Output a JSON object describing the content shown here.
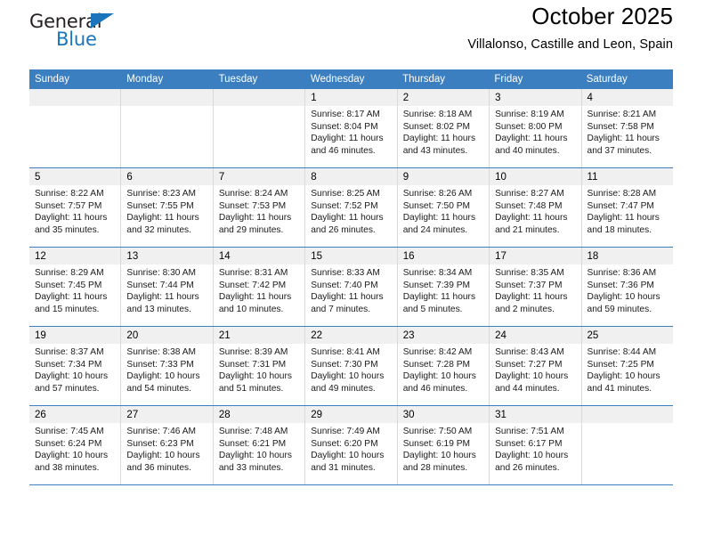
{
  "brand": {
    "name_top": "General",
    "name_bottom": "Blue",
    "triangle_color": "#1b75bb"
  },
  "header": {
    "title": "October 2025",
    "subtitle": "Villalonso, Castille and Leon, Spain"
  },
  "theme": {
    "header_bg": "#3c7fc0",
    "header_text": "#ffffff",
    "daynum_band_bg": "#f0f0f0",
    "cell_border": "#d9d9d9",
    "week_rule": "#3c7fc0"
  },
  "weekday_headers": [
    "Sunday",
    "Monday",
    "Tuesday",
    "Wednesday",
    "Thursday",
    "Friday",
    "Saturday"
  ],
  "weeks": [
    [
      {
        "day": "",
        "empty": true,
        "sunrise": "",
        "sunset": "",
        "daylight_line1": "",
        "daylight_line2": ""
      },
      {
        "day": "",
        "empty": true,
        "sunrise": "",
        "sunset": "",
        "daylight_line1": "",
        "daylight_line2": ""
      },
      {
        "day": "",
        "empty": true,
        "sunrise": "",
        "sunset": "",
        "daylight_line1": "",
        "daylight_line2": ""
      },
      {
        "day": "1",
        "empty": false,
        "sunrise": "Sunrise: 8:17 AM",
        "sunset": "Sunset: 8:04 PM",
        "daylight_line1": "Daylight: 11 hours",
        "daylight_line2": "and 46 minutes."
      },
      {
        "day": "2",
        "empty": false,
        "sunrise": "Sunrise: 8:18 AM",
        "sunset": "Sunset: 8:02 PM",
        "daylight_line1": "Daylight: 11 hours",
        "daylight_line2": "and 43 minutes."
      },
      {
        "day": "3",
        "empty": false,
        "sunrise": "Sunrise: 8:19 AM",
        "sunset": "Sunset: 8:00 PM",
        "daylight_line1": "Daylight: 11 hours",
        "daylight_line2": "and 40 minutes."
      },
      {
        "day": "4",
        "empty": false,
        "sunrise": "Sunrise: 8:21 AM",
        "sunset": "Sunset: 7:58 PM",
        "daylight_line1": "Daylight: 11 hours",
        "daylight_line2": "and 37 minutes."
      }
    ],
    [
      {
        "day": "5",
        "empty": false,
        "sunrise": "Sunrise: 8:22 AM",
        "sunset": "Sunset: 7:57 PM",
        "daylight_line1": "Daylight: 11 hours",
        "daylight_line2": "and 35 minutes."
      },
      {
        "day": "6",
        "empty": false,
        "sunrise": "Sunrise: 8:23 AM",
        "sunset": "Sunset: 7:55 PM",
        "daylight_line1": "Daylight: 11 hours",
        "daylight_line2": "and 32 minutes."
      },
      {
        "day": "7",
        "empty": false,
        "sunrise": "Sunrise: 8:24 AM",
        "sunset": "Sunset: 7:53 PM",
        "daylight_line1": "Daylight: 11 hours",
        "daylight_line2": "and 29 minutes."
      },
      {
        "day": "8",
        "empty": false,
        "sunrise": "Sunrise: 8:25 AM",
        "sunset": "Sunset: 7:52 PM",
        "daylight_line1": "Daylight: 11 hours",
        "daylight_line2": "and 26 minutes."
      },
      {
        "day": "9",
        "empty": false,
        "sunrise": "Sunrise: 8:26 AM",
        "sunset": "Sunset: 7:50 PM",
        "daylight_line1": "Daylight: 11 hours",
        "daylight_line2": "and 24 minutes."
      },
      {
        "day": "10",
        "empty": false,
        "sunrise": "Sunrise: 8:27 AM",
        "sunset": "Sunset: 7:48 PM",
        "daylight_line1": "Daylight: 11 hours",
        "daylight_line2": "and 21 minutes."
      },
      {
        "day": "11",
        "empty": false,
        "sunrise": "Sunrise: 8:28 AM",
        "sunset": "Sunset: 7:47 PM",
        "daylight_line1": "Daylight: 11 hours",
        "daylight_line2": "and 18 minutes."
      }
    ],
    [
      {
        "day": "12",
        "empty": false,
        "sunrise": "Sunrise: 8:29 AM",
        "sunset": "Sunset: 7:45 PM",
        "daylight_line1": "Daylight: 11 hours",
        "daylight_line2": "and 15 minutes."
      },
      {
        "day": "13",
        "empty": false,
        "sunrise": "Sunrise: 8:30 AM",
        "sunset": "Sunset: 7:44 PM",
        "daylight_line1": "Daylight: 11 hours",
        "daylight_line2": "and 13 minutes."
      },
      {
        "day": "14",
        "empty": false,
        "sunrise": "Sunrise: 8:31 AM",
        "sunset": "Sunset: 7:42 PM",
        "daylight_line1": "Daylight: 11 hours",
        "daylight_line2": "and 10 minutes."
      },
      {
        "day": "15",
        "empty": false,
        "sunrise": "Sunrise: 8:33 AM",
        "sunset": "Sunset: 7:40 PM",
        "daylight_line1": "Daylight: 11 hours",
        "daylight_line2": "and 7 minutes."
      },
      {
        "day": "16",
        "empty": false,
        "sunrise": "Sunrise: 8:34 AM",
        "sunset": "Sunset: 7:39 PM",
        "daylight_line1": "Daylight: 11 hours",
        "daylight_line2": "and 5 minutes."
      },
      {
        "day": "17",
        "empty": false,
        "sunrise": "Sunrise: 8:35 AM",
        "sunset": "Sunset: 7:37 PM",
        "daylight_line1": "Daylight: 11 hours",
        "daylight_line2": "and 2 minutes."
      },
      {
        "day": "18",
        "empty": false,
        "sunrise": "Sunrise: 8:36 AM",
        "sunset": "Sunset: 7:36 PM",
        "daylight_line1": "Daylight: 10 hours",
        "daylight_line2": "and 59 minutes."
      }
    ],
    [
      {
        "day": "19",
        "empty": false,
        "sunrise": "Sunrise: 8:37 AM",
        "sunset": "Sunset: 7:34 PM",
        "daylight_line1": "Daylight: 10 hours",
        "daylight_line2": "and 57 minutes."
      },
      {
        "day": "20",
        "empty": false,
        "sunrise": "Sunrise: 8:38 AM",
        "sunset": "Sunset: 7:33 PM",
        "daylight_line1": "Daylight: 10 hours",
        "daylight_line2": "and 54 minutes."
      },
      {
        "day": "21",
        "empty": false,
        "sunrise": "Sunrise: 8:39 AM",
        "sunset": "Sunset: 7:31 PM",
        "daylight_line1": "Daylight: 10 hours",
        "daylight_line2": "and 51 minutes."
      },
      {
        "day": "22",
        "empty": false,
        "sunrise": "Sunrise: 8:41 AM",
        "sunset": "Sunset: 7:30 PM",
        "daylight_line1": "Daylight: 10 hours",
        "daylight_line2": "and 49 minutes."
      },
      {
        "day": "23",
        "empty": false,
        "sunrise": "Sunrise: 8:42 AM",
        "sunset": "Sunset: 7:28 PM",
        "daylight_line1": "Daylight: 10 hours",
        "daylight_line2": "and 46 minutes."
      },
      {
        "day": "24",
        "empty": false,
        "sunrise": "Sunrise: 8:43 AM",
        "sunset": "Sunset: 7:27 PM",
        "daylight_line1": "Daylight: 10 hours",
        "daylight_line2": "and 44 minutes."
      },
      {
        "day": "25",
        "empty": false,
        "sunrise": "Sunrise: 8:44 AM",
        "sunset": "Sunset: 7:25 PM",
        "daylight_line1": "Daylight: 10 hours",
        "daylight_line2": "and 41 minutes."
      }
    ],
    [
      {
        "day": "26",
        "empty": false,
        "sunrise": "Sunrise: 7:45 AM",
        "sunset": "Sunset: 6:24 PM",
        "daylight_line1": "Daylight: 10 hours",
        "daylight_line2": "and 38 minutes."
      },
      {
        "day": "27",
        "empty": false,
        "sunrise": "Sunrise: 7:46 AM",
        "sunset": "Sunset: 6:23 PM",
        "daylight_line1": "Daylight: 10 hours",
        "daylight_line2": "and 36 minutes."
      },
      {
        "day": "28",
        "empty": false,
        "sunrise": "Sunrise: 7:48 AM",
        "sunset": "Sunset: 6:21 PM",
        "daylight_line1": "Daylight: 10 hours",
        "daylight_line2": "and 33 minutes."
      },
      {
        "day": "29",
        "empty": false,
        "sunrise": "Sunrise: 7:49 AM",
        "sunset": "Sunset: 6:20 PM",
        "daylight_line1": "Daylight: 10 hours",
        "daylight_line2": "and 31 minutes."
      },
      {
        "day": "30",
        "empty": false,
        "sunrise": "Sunrise: 7:50 AM",
        "sunset": "Sunset: 6:19 PM",
        "daylight_line1": "Daylight: 10 hours",
        "daylight_line2": "and 28 minutes."
      },
      {
        "day": "31",
        "empty": false,
        "sunrise": "Sunrise: 7:51 AM",
        "sunset": "Sunset: 6:17 PM",
        "daylight_line1": "Daylight: 10 hours",
        "daylight_line2": "and 26 minutes."
      },
      {
        "day": "",
        "empty": true,
        "sunrise": "",
        "sunset": "",
        "daylight_line1": "",
        "daylight_line2": ""
      }
    ]
  ]
}
